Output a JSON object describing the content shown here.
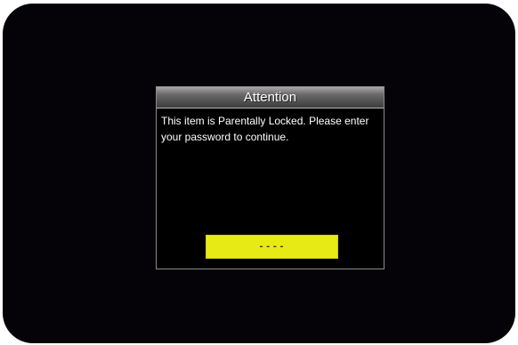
{
  "dialog": {
    "title": "Attention",
    "message": "This item is Parentally Locked. Please enter your password to continue.",
    "password": {
      "value": "----"
    }
  },
  "colors": {
    "screen_bg": "#050308",
    "field_bg": "#e8ea16",
    "text": "#ffffff"
  }
}
